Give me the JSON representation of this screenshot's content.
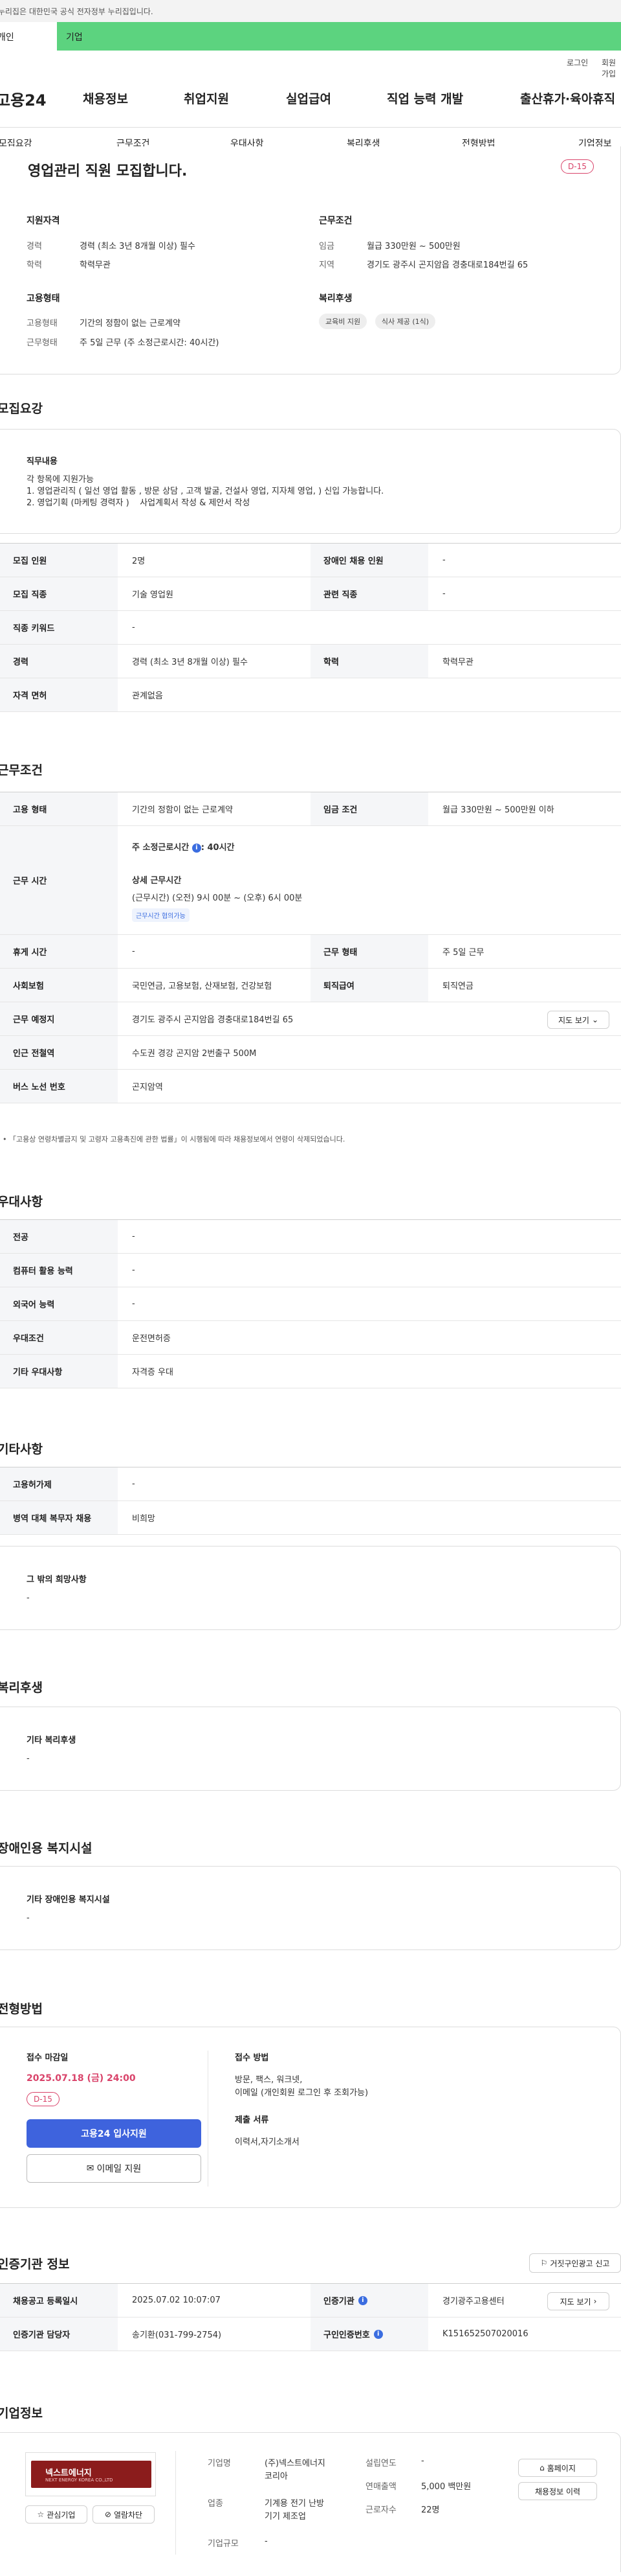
{
  "topbar": {
    "notice": "이 누리집은 대한민국 공식 전자정부 누리집입니다."
  },
  "tabs": {
    "personal": "개인",
    "company": "기업"
  },
  "utility": {
    "login": "로그인",
    "join": "회원가입"
  },
  "gnb": {
    "logo": "고용24",
    "m1": "채용정보",
    "m2": "취업지원",
    "m3": "실업급여",
    "m4": "직업 능력 개발",
    "m5": "출산휴가·육아휴직"
  },
  "sectabs": [
    "모집요강",
    "근무조건",
    "우대사항",
    "복리후생",
    "전형방법",
    "기업정보"
  ],
  "summary": {
    "title": "영업관리 직원 모집합니다.",
    "dday": "D-15",
    "qual_title": "지원자격",
    "career_k": "경력",
    "career_v": "경력 (최소 3년 8개월 이상) 필수",
    "edu_k": "학력",
    "edu_v": "학력무관",
    "cond_title": "근무조건",
    "wage_k": "임금",
    "wage_v": "월급 330만원 ~ 500만원",
    "loc_k": "지역",
    "loc_v": "경기도 광주시 곤지암읍 경충대로184번길 65",
    "emp_title": "고용형태",
    "emptype_k": "고용형태",
    "emptype_v": "기간의 정함이 없는 근로계약",
    "hours_k": "근무형태",
    "hours_v": "주 5일 근무 (주 소정근로시간: 40시간)",
    "welfare_title": "복리후생",
    "chip1": "교육비 지원",
    "chip2": "식사 제공 (1식)"
  },
  "recruit": {
    "title": "모집요강",
    "job_head": "직무내용",
    "job_l1": "각 항목에 지원가능",
    "job_l2": "1. 영업관리직 ( 일선 영업 활동 , 방문 상담 , 고객 발굴, 건설사 영업, 지자체 영업, ) 신입 가능합니다.",
    "job_l3": "2. 영업기획 (마케팅 경력자 )    사업계획서 작성 & 제안서 작성"
  },
  "recruit_table": [
    [
      "모집 인원",
      "2명",
      "장애인 채용 인원",
      "-"
    ],
    [
      "모집 직종",
      "기술 영업원",
      "관련 직종",
      "-"
    ],
    [
      "직종 키워드",
      "-",
      "",
      ""
    ],
    [
      "경력",
      "경력 (최소 3년 8개월 이상) 필수",
      "학력",
      "학력무관"
    ],
    [
      "자격 면허",
      "관계없음",
      "",
      ""
    ]
  ],
  "cond": {
    "title": "근무조건",
    "emp_k": "고용 형태",
    "emp_v": "기간의 정함이 없는 근로계약",
    "wage_k": "임금 조건",
    "wage_v": "월급 330만원 ~ 500만원 이하",
    "time_k": "근무 시간",
    "time_l1": "주 소정근로시간",
    "time_l1b": ": 40시간",
    "time_l2": "상세 근무시간",
    "time_l3": "(근무시간) (오전) 9시 00분 ~ (오후) 6시 00분",
    "time_chip": "근무시간 협의가능",
    "rest_k": "휴게 시간",
    "rest_v": "-",
    "form_k": "근무 형태",
    "form_v": "주 5일 근무",
    "ins_k": "사회보험",
    "ins_v": "국민연금, 고용보험, 산재보험, 건강보험",
    "ret_k": "퇴직급여",
    "ret_v": "퇴직연금",
    "place_k": "근무 예정지",
    "place_v": "경기도 광주시 곤지암읍 경충대로184번길 65",
    "map_btn": "지도 보기",
    "sub_k": "인근 전철역",
    "sub_v": "수도권 경강 곤지암 2번출구 500M",
    "bus_k": "버스 노선 번호",
    "bus_v": "곤지암역",
    "note": "「고용상 연령차별금지 및 고령자 고용촉진에 관한 법률」이 시행됨에 따라 채용정보에서 연령이 삭제되었습니다."
  },
  "pref": {
    "title": "우대사항",
    "rows": [
      [
        "전공",
        "-"
      ],
      [
        "컴퓨터 활용 능력",
        "-"
      ],
      [
        "외국어 능력",
        "-"
      ],
      [
        "우대조건",
        "운전면허증"
      ],
      [
        "기타 우대사항",
        "자격증 우대"
      ]
    ]
  },
  "other": {
    "title": "기타사항",
    "rows": [
      [
        "고용허가제",
        "-"
      ],
      [
        "병역 대체 복무자 채용",
        "비희망"
      ]
    ],
    "wish_head": "그 밖의 희망사항",
    "wish_v": "-"
  },
  "welfare": {
    "title": "복리후생",
    "head": "기타 복리후생",
    "v": "-"
  },
  "disabled": {
    "title": "장애인용 복지시설",
    "head": "기타 장애인용 복지시설",
    "v": "-"
  },
  "apply": {
    "title": "전형방법",
    "deadline_k": "접수 마감일",
    "deadline_v": "2025.07.18 (금) 24:00",
    "dday": "D-15",
    "btn1": "고용24 입사지원",
    "btn2": "이메일 지원",
    "method_k": "접수 방법",
    "method_v1": "방문, 팩스, 워크넷,",
    "method_v2": "이메일 (개인회원 로그인 후 조회가능)",
    "doc_k": "제출 서류",
    "doc_v": "이력서,자기소개서"
  },
  "cert": {
    "title": "인증기관 정보",
    "report_btn": "거짓구인광고 신고",
    "reg_k": "채용공고 등록일시",
    "reg_v": "2025.07.02 10:07:07",
    "org_k": "인증기관",
    "org_v": "경기광주고용센터",
    "map_btn": "지도 보기",
    "mgr_k": "인증기관 담당자",
    "mgr_v": "송기환(031-799-2754)",
    "no_k": "구인인증번호",
    "no_v": "K151652507020016"
  },
  "company": {
    "title": "기업정보",
    "logo_text": "넥스트에너지",
    "logo_sub": "NEXT ENERGY KOREA CO.,LTD",
    "fav_btn": "관심기업",
    "block_btn": "열람차단",
    "name_k": "기업명",
    "name_v1": "(주)넥스트에너지",
    "name_v2": "코리아",
    "year_k": "설립연도",
    "year_v": "-",
    "ind_k": "업종",
    "ind_v1": "기계용 전기 난방",
    "ind_v2": "기기 제조업",
    "sales_k": "연매출액",
    "sales_v": "5,000 백만원",
    "size_k": "기업규모",
    "size_v": "-",
    "emp_k": "근로자수",
    "emp_v": "22명",
    "home_btn": "홈페이지",
    "hist_btn": "채용정보 이력"
  }
}
